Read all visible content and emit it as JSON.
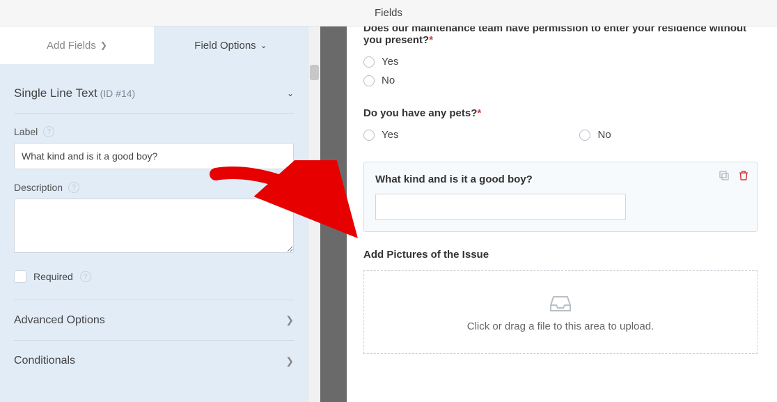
{
  "header": {
    "title": "Fields"
  },
  "tabs": {
    "add_fields": "Add Fields",
    "field_options": "Field Options"
  },
  "field_options": {
    "type_name": "Single Line Text",
    "id_prefix": "(ID #",
    "id_num": "14",
    "id_suffix": ")",
    "label_label": "Label",
    "label_value": "What kind and is it a good boy?",
    "description_label": "Description",
    "required_label": "Required",
    "advanced_label": "Advanced Options",
    "conditionals_label": "Conditionals"
  },
  "preview": {
    "q1": "Does our maintenance team have permission to enter your residence without you present?",
    "q1_opts": {
      "yes": "Yes",
      "no": "No"
    },
    "q2": "Do you have any pets?",
    "q2_opts": {
      "yes": "Yes",
      "no": "No"
    },
    "selected_label": "What kind and is it a good boy?",
    "upload_label": "Add Pictures of the Issue",
    "dropzone_text": "Click or drag a file to this area to upload."
  }
}
